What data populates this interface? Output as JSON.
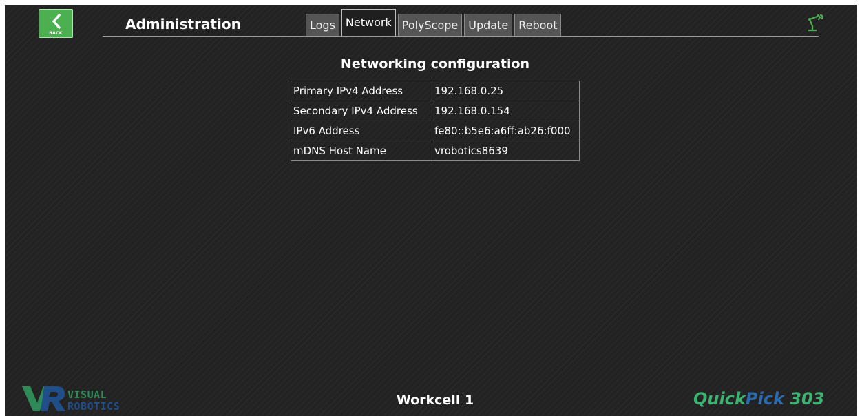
{
  "header": {
    "back_label": "BACK",
    "title": "Administration"
  },
  "tabs": [
    {
      "label": "Logs",
      "active": false
    },
    {
      "label": "Network",
      "active": true
    },
    {
      "label": "PolyScope",
      "active": false
    },
    {
      "label": "Update",
      "active": false
    },
    {
      "label": "Reboot",
      "active": false
    }
  ],
  "main": {
    "section_title": "Networking configuration",
    "rows": [
      {
        "label": "Primary IPv4 Address",
        "value": "192.168.0.25"
      },
      {
        "label": "Secondary IPv4 Address",
        "value": "192.168.0.154"
      },
      {
        "label": "IPv6 Address",
        "value": "fe80::b5e6:a6ff:ab26:f000"
      },
      {
        "label": "mDNS Host Name",
        "value": "vrobotics8639"
      }
    ]
  },
  "footer": {
    "logo_line1": "VISUAL",
    "logo_line2": "ROBOTICS",
    "workcell": "Workcell 1",
    "product_part1": "Quick",
    "product_part2": "Pick",
    "product_part3": " 303"
  },
  "icons": {
    "back": "chevron-left-icon",
    "robot": "robot-arm-icon"
  },
  "colors": {
    "accent_green": "#4caf50",
    "brand_blue": "#2a6aad",
    "background": "#222222"
  }
}
